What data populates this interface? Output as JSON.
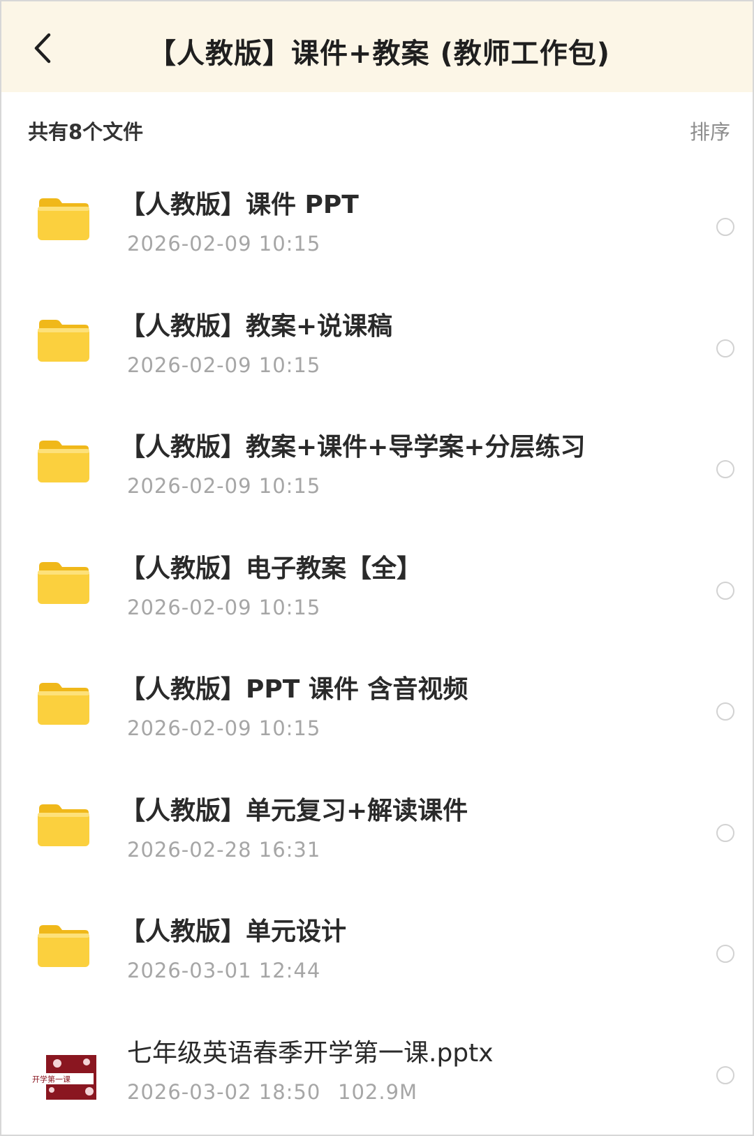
{
  "header": {
    "title": "【人教版】课件+教案 (教师工作包)"
  },
  "summary": {
    "count_label": "共有8个文件",
    "sort_label": "排序"
  },
  "colors": {
    "header_bg": "#fcf6e7",
    "folder_yellow": "#f8c92a",
    "date_gray": "#a6a6a6"
  },
  "items": [
    {
      "name": "【人教版】课件 PPT",
      "date": "2026-02-09 10:15",
      "icon": "folder-icon"
    },
    {
      "name": "【人教版】教案+说课稿",
      "date": "2026-02-09 10:15",
      "icon": "folder-icon"
    },
    {
      "name": "【人教版】教案+课件+导学案+分层练习",
      "date": "2026-02-09 10:15",
      "icon": "folder-icon"
    },
    {
      "name": "【人教版】电子教案【全】",
      "date": "2026-02-09 10:15",
      "icon": "folder-icon"
    },
    {
      "name": "【人教版】PPT 课件 含音视频",
      "date": "2026-02-09 10:15",
      "icon": "folder-icon"
    },
    {
      "name": "【人教版】单元复习+解读课件",
      "date": "2026-02-28 16:31",
      "icon": "folder-icon"
    },
    {
      "name": "【人教版】单元设计",
      "date": "2026-03-01 12:44",
      "icon": "folder-icon"
    },
    {
      "name": "七年级英语春季开学第一课.pptx",
      "date": "2026-03-02 18:50",
      "size": "102.9M",
      "icon": "pptx-thumbnail",
      "thumb_text": "开学第一课"
    }
  ]
}
